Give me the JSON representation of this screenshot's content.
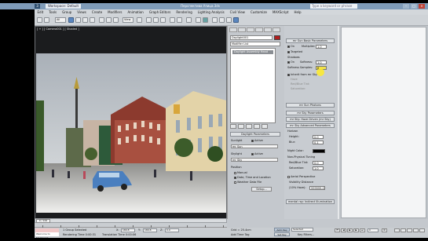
{
  "titlebar": {
    "workspace": "Workspace: Default",
    "title": "Перспектива Улица.3ds",
    "search_placeholder": "Type a keyword or phrase",
    "logo": "3"
  },
  "menu": [
    "Edit",
    "Tools",
    "Group",
    "Views",
    "Create",
    "Modifiers",
    "Animation",
    "Graph Editors",
    "Rendering",
    "Lighting Analysis",
    "Civil View",
    "Customize",
    "MAXScript",
    "Help"
  ],
  "toolbar": {
    "selection_filter": "All",
    "view_ref": "View"
  },
  "viewport": {
    "label": "[ + ] [ Camera001 ] [ Shaded ]"
  },
  "command_panel": {
    "object_name": "Daylight001",
    "modifier_list": "Modifier List",
    "stack_item": "Daylight Assembly Head",
    "daylight_rollout": "Daylight Parameters",
    "sunlight_label": "Sunlight",
    "sunlight_active": "Active",
    "sunlight_type": "mr Sun",
    "skylight_label": "Skylight",
    "skylight_active": "Active",
    "skylight_type": "mr Sky",
    "position_label": "Position",
    "manual": "Manual",
    "date_time": "Date, Time and Location",
    "weather": "Weather Data File",
    "setup": "Setup..."
  },
  "right_panel": {
    "sun_basic": "mr Sun Basic Parameters",
    "on": "On",
    "multiplier_label": "Multiplier:",
    "multiplier": "1.0",
    "targeted": "Targeted",
    "shadows": "Shadows",
    "shadows_on": "On",
    "softness_label": "Softness:",
    "softness": "1.0",
    "softness_samples_label": "Softness Samples:",
    "softness_samples": "8",
    "inherit": "Inherit from mr Sky",
    "haze": "Haze",
    "red_blue": "Red/Blue Tint:",
    "saturation": "Saturation:",
    "sun_photons": "mr Sun Photons",
    "sky_params": "mr Sky Parameters",
    "sky_haze": "mr Sky: Haze Driven (mr Sky)",
    "sky_advanced": "mr Sky Advanced Parameters",
    "horizon": "Horizon",
    "height_label": "Height:",
    "height_val": "0.0",
    "blur_label": "Blur:",
    "blur_val": "0.1",
    "night_color": "Night Color:",
    "non_physical": "Non-Physical Tuning",
    "red_blue_tint": "Red/Blue Tint:",
    "red_blue_val": "0.0",
    "saturation2": "Saturation:",
    "saturation_val": "1.0",
    "aerial": "Aerial Perspective",
    "visibility": "Visibility Distance",
    "visibility_pct": "(10% Haze):",
    "visibility_val": "999999.0",
    "indirect": "mental ray: Indirect Illumination"
  },
  "timeline": {
    "frame": "0 / 100",
    "ticks": [
      "0",
      "10",
      "20",
      "30",
      "40",
      "50",
      "60",
      "70",
      "80",
      "90",
      "100"
    ]
  },
  "status": {
    "maxscript_label": "Welcome to MAXScript",
    "selected": "1 Group Selected",
    "rendering_time": "Rendering Time 0:00:31",
    "translation_time": "Translation Time 0:00:06",
    "x": "180.8",
    "y": "180.8",
    "z": "0.0",
    "grid": "Grid = 25.4cm",
    "auto_key": "Auto Key",
    "set_key": "Set Key",
    "selected_dd": "Selected",
    "add_time_tag": "Add Time Tag",
    "key_filters": "Key Filters...",
    "frame_field": "0"
  }
}
